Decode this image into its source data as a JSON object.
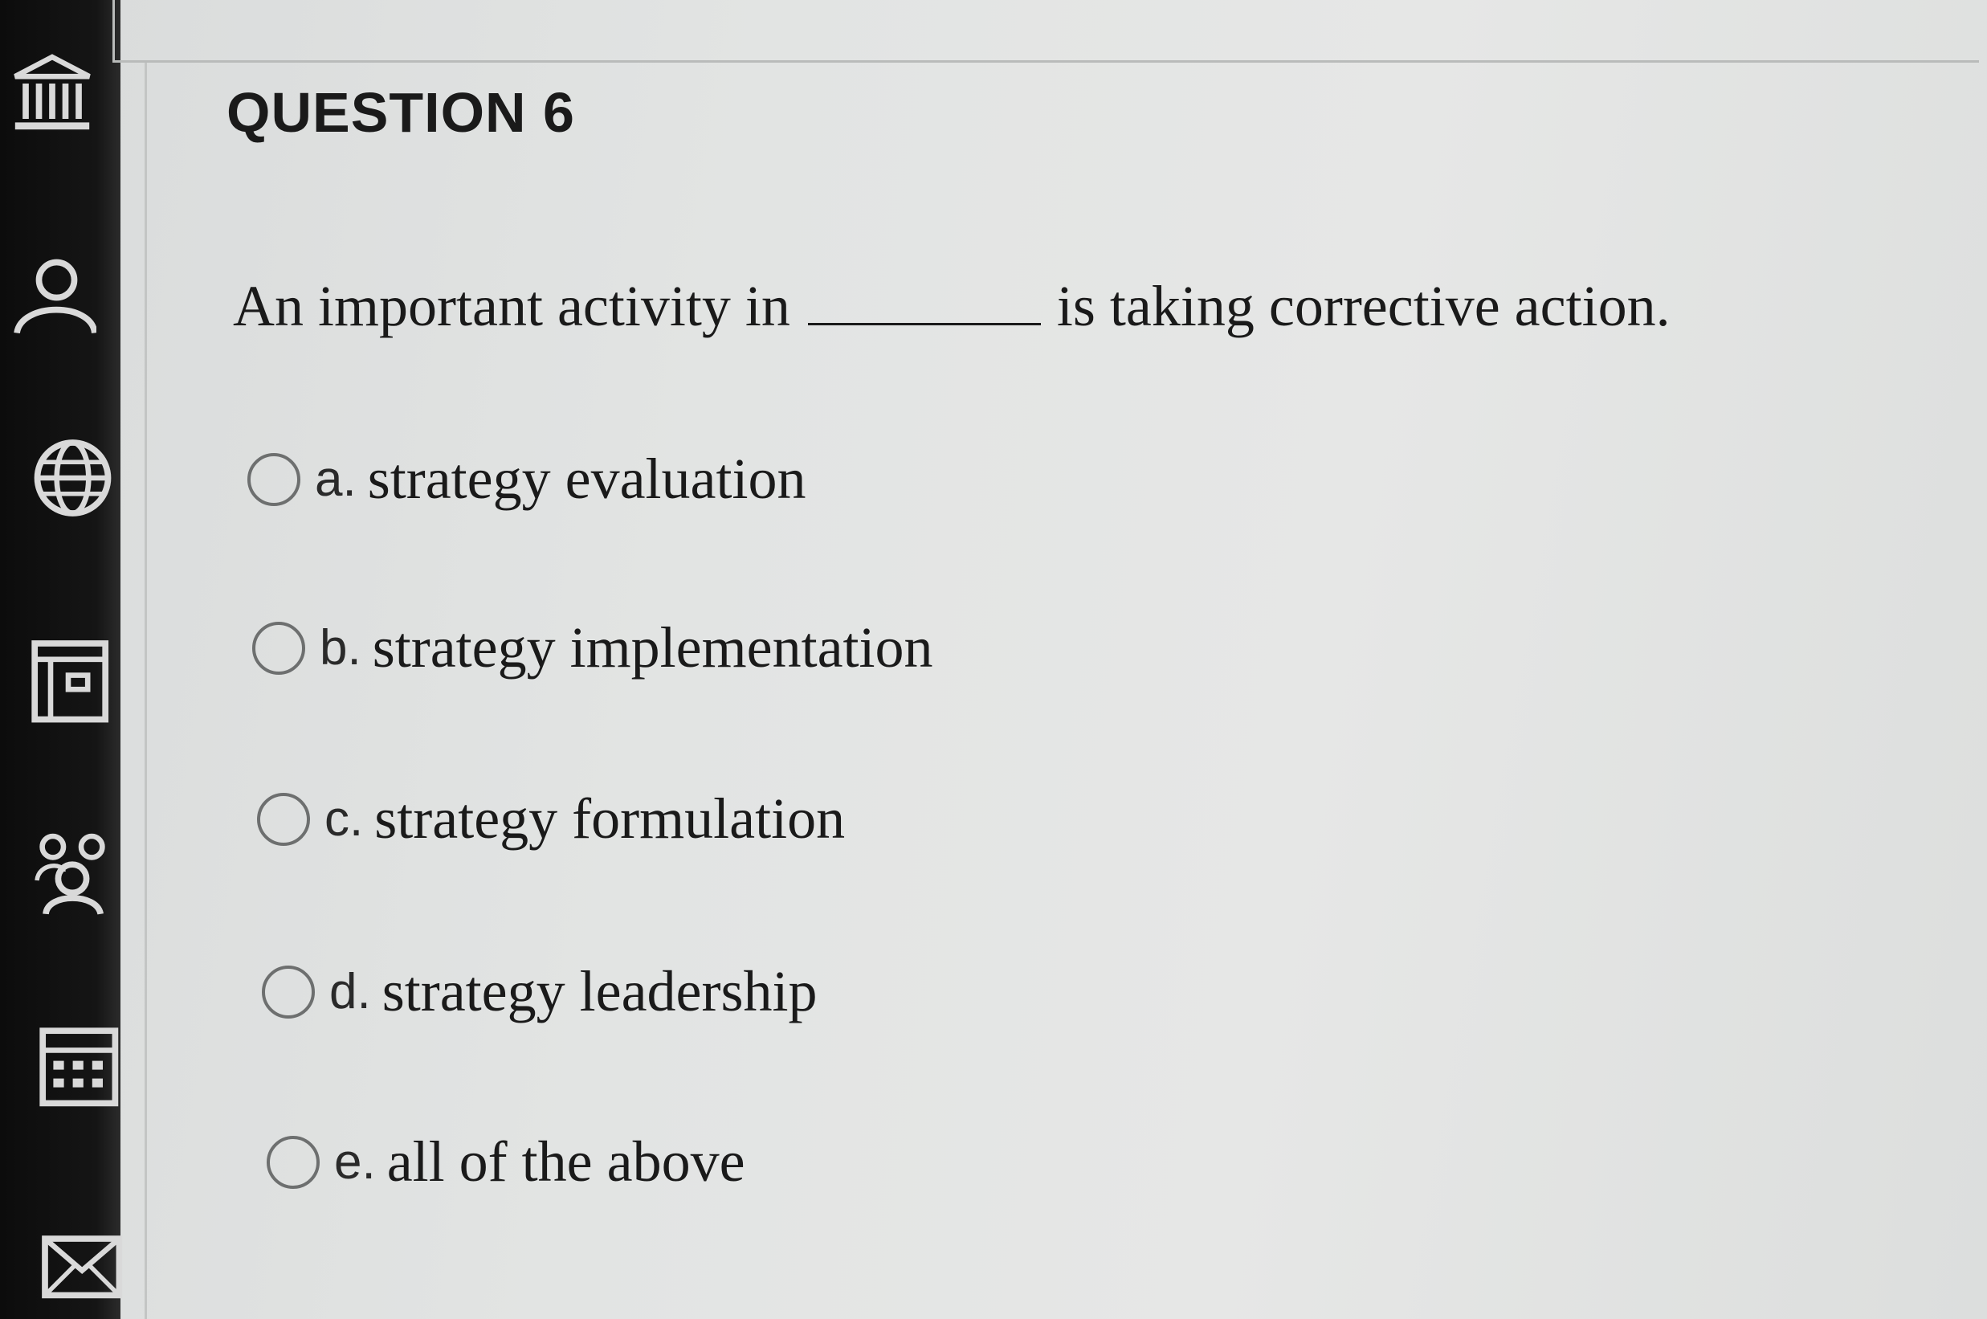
{
  "sidebar": {
    "icons": [
      {
        "name": "institution-icon"
      },
      {
        "name": "user-icon"
      },
      {
        "name": "globe-icon"
      },
      {
        "name": "courses-icon"
      },
      {
        "name": "groups-icon"
      },
      {
        "name": "calendar-icon"
      },
      {
        "name": "mail-icon"
      }
    ]
  },
  "question": {
    "title": "QUESTION 6",
    "text_before": "An important activity in",
    "text_after": "is taking corrective action.",
    "options": [
      {
        "letter": "a.",
        "text": "strategy evaluation"
      },
      {
        "letter": "b.",
        "text": "strategy implementation"
      },
      {
        "letter": "c.",
        "text": "strategy formulation"
      },
      {
        "letter": "d.",
        "text": "strategy leadership"
      },
      {
        "letter": "e.",
        "text": "all of the above"
      }
    ]
  }
}
